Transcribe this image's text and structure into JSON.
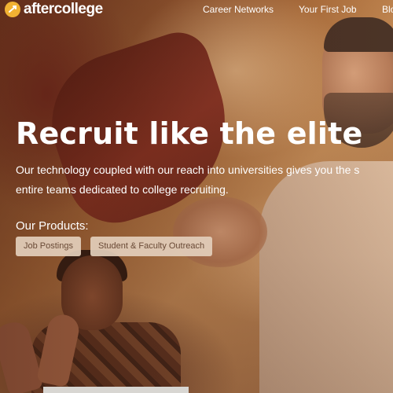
{
  "brand": {
    "name": "aftercollege",
    "logo_icon": "aftercollege-logo-icon",
    "accent": "#f2b233"
  },
  "nav": {
    "links": [
      "Career Networks",
      "Your First Job",
      "Blo"
    ]
  },
  "hero": {
    "headline": "Recruit like the elite",
    "subtext_lines": [
      "Our technology coupled with our reach into universities gives you the s",
      "entire teams dedicated to college recruiting."
    ],
    "products_label": "Our Products:",
    "products": [
      "Job Postings",
      "Student & Faculty Outreach"
    ]
  },
  "colors": {
    "chip_bg": "#e2ceba",
    "chip_text": "#6a4a36",
    "text": "#ffffff"
  }
}
